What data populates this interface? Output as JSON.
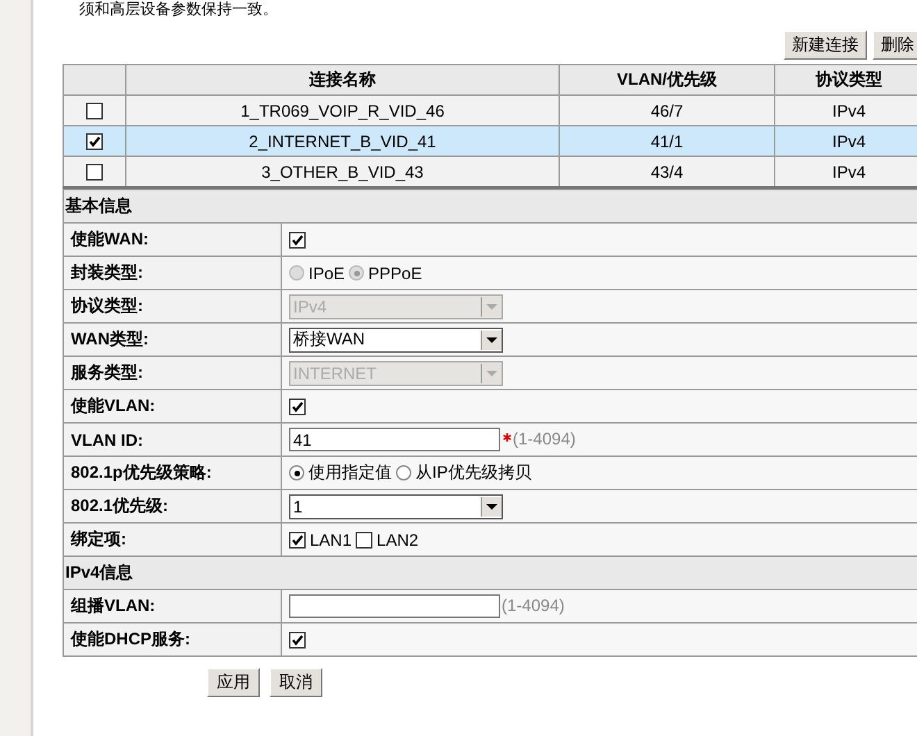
{
  "intro": "须和高层设备参数保持一致。",
  "toolbar": [
    "新建连接",
    "删除"
  ],
  "connections": {
    "columns": [
      "连接名称",
      "VLAN/优先级",
      "协议类型"
    ],
    "rows": [
      {
        "selected": false,
        "name": "1_TR069_VOIP_R_VID_46",
        "vlan": "46/7",
        "protocol": "IPv4"
      },
      {
        "selected": true,
        "name": "2_INTERNET_B_VID_41",
        "vlan": "41/1",
        "protocol": "IPv4"
      },
      {
        "selected": false,
        "name": "3_OTHER_B_VID_43",
        "vlan": "43/4",
        "protocol": "IPv4"
      }
    ]
  },
  "sections": [
    {
      "title": "基本信息",
      "rows": [
        {
          "label": "使能WAN:",
          "kind": "checkbox",
          "checked": true
        },
        {
          "label": "封装类型:",
          "kind": "radio",
          "disabled": true,
          "options": [
            {
              "label": "IPoE",
              "selected": false
            },
            {
              "label": "PPPoE",
              "selected": true
            }
          ]
        },
        {
          "label": "协议类型:",
          "kind": "select",
          "value": "IPv4",
          "disabled": true
        },
        {
          "label": "WAN类型:",
          "kind": "select",
          "value": "桥接WAN",
          "disabled": false
        },
        {
          "label": "服务类型:",
          "kind": "select",
          "value": "INTERNET",
          "disabled": true
        },
        {
          "label": "使能VLAN:",
          "kind": "checkbox",
          "checked": true
        },
        {
          "label": "VLAN ID:",
          "kind": "input",
          "value": "41",
          "required": true,
          "hint": "(1-4094)"
        },
        {
          "label": "802.1p优先级策略:",
          "kind": "radio",
          "disabled": false,
          "options": [
            {
              "label": "使用指定值",
              "selected": true
            },
            {
              "label": "从IP优先级拷贝",
              "selected": false
            }
          ]
        },
        {
          "label": "802.1优先级:",
          "kind": "select",
          "value": "1",
          "disabled": false
        },
        {
          "label": "绑定项:",
          "kind": "checks",
          "options": [
            {
              "label": "LAN1",
              "checked": true
            },
            {
              "label": "LAN2",
              "checked": false
            }
          ]
        }
      ]
    },
    {
      "title": "IPv4信息",
      "rows": [
        {
          "label": "组播VLAN:",
          "kind": "input",
          "value": "",
          "required": false,
          "hint": "(1-4094)"
        },
        {
          "label": "使能DHCP服务:",
          "kind": "checkbox",
          "checked": true
        }
      ]
    }
  ],
  "buttons": [
    "应用",
    "取消"
  ]
}
